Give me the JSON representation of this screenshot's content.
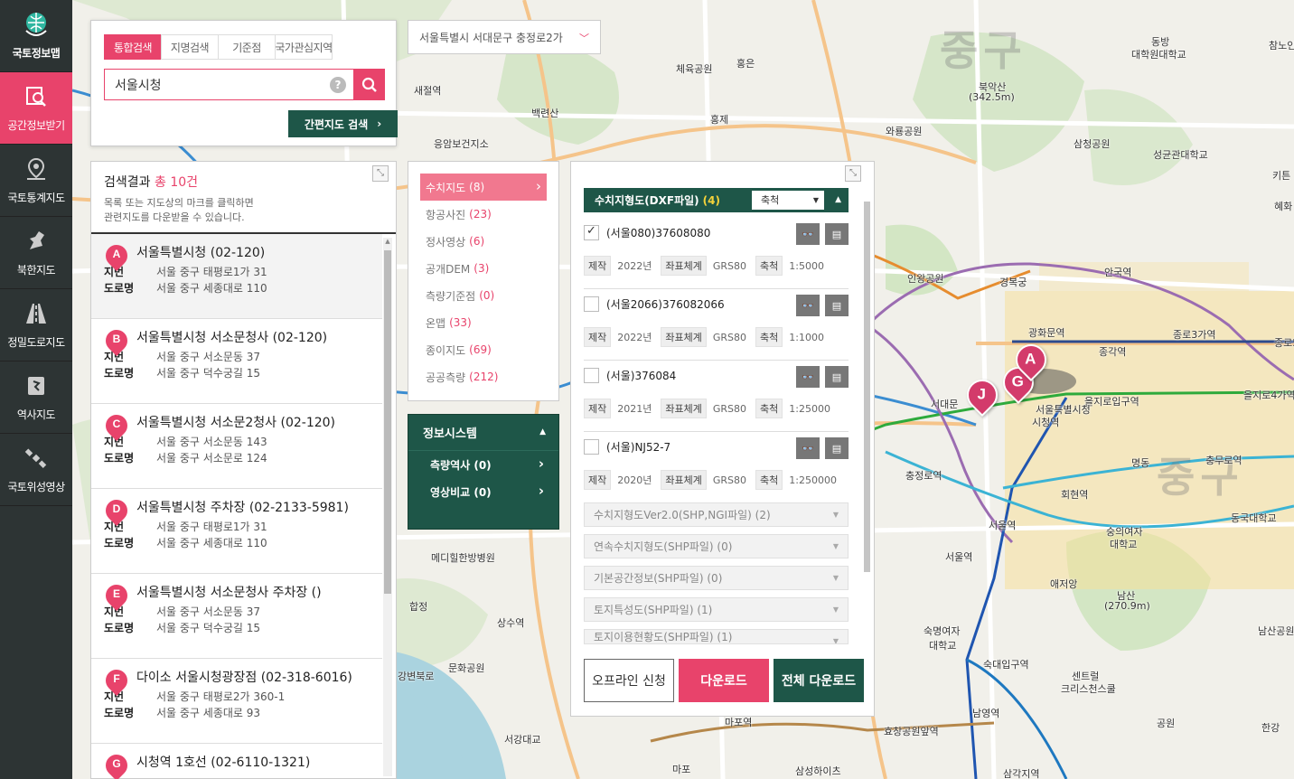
{
  "nav": [
    {
      "label": "국토정보맵",
      "icon": "globe-icon"
    },
    {
      "label": "공간정보받기",
      "icon": "map-search-icon"
    },
    {
      "label": "국토통계지도",
      "icon": "map-pin-icon"
    },
    {
      "label": "북한지도",
      "icon": "north-korea-map-icon"
    },
    {
      "label": "정밀도로지도",
      "icon": "road-icon"
    },
    {
      "label": "역사지도",
      "icon": "history-map-icon"
    },
    {
      "label": "국토위성영상",
      "icon": "satellite-icon"
    }
  ],
  "search": {
    "tabs": [
      "통합검색",
      "지명검색",
      "기준점",
      "국가관심지역"
    ],
    "query": "서울시청",
    "help": "?",
    "simple_btn": "간편지도 검색"
  },
  "address": "서울특별시 서대문구 충정로2가",
  "results": {
    "title_prefix": "검색결과",
    "title_total": "총 10건",
    "desc_line1": "목록 또는 지도상의 마크를 클릭하면",
    "desc_line2": "관련지도를 다운받을 수 있습니다.",
    "lot_label": "지번",
    "road_label": "도로명",
    "items": [
      {
        "marker": "A",
        "name": "서울특별시청 (02-120)",
        "lot": "서울 중구 태평로1가 31",
        "road": "서울 중구 세종대로 110"
      },
      {
        "marker": "B",
        "name": "서울특별시청 서소문청사 (02-120)",
        "lot": "서울 중구 서소문동 37",
        "road": "서울 중구 덕수궁길 15"
      },
      {
        "marker": "C",
        "name": "서울특별시청 서소문2청사 (02-120)",
        "lot": "서울 중구 서소문동 143",
        "road": "서울 중구 서소문로 124"
      },
      {
        "marker": "D",
        "name": "서울특별시청 주차장 (02-2133-5981)",
        "lot": "서울 중구 태평로1가 31",
        "road": "서울 중구 세종대로 110"
      },
      {
        "marker": "E",
        "name": "서울특별시청 서소문청사 주차장 ()",
        "lot": "서울 중구 서소문동 37",
        "road": "서울 중구 덕수궁길 15"
      },
      {
        "marker": "F",
        "name": "다이소 서울시청광장점 (02-318-6016)",
        "lot": "서울 중구 태평로2가 360-1",
        "road": "서울 중구 세종대로 93"
      },
      {
        "marker": "G",
        "name": "시청역 1호선 (02-6110-1321)",
        "lot": "",
        "road": ""
      }
    ]
  },
  "categories": [
    {
      "label": "수치지도",
      "count": "(8)"
    },
    {
      "label": "항공사진",
      "count": "(23)"
    },
    {
      "label": "정사영상",
      "count": "(6)"
    },
    {
      "label": "공개DEM",
      "count": "(3)"
    },
    {
      "label": "측량기준점",
      "count": "(0)"
    },
    {
      "label": "온맵",
      "count": "(33)"
    },
    {
      "label": "종이지도",
      "count": "(69)"
    },
    {
      "label": "공공측량",
      "count": "(212)"
    }
  ],
  "infosys": {
    "title": "정보시스템",
    "items": [
      "측량역사 (0)",
      "영상비교 (0)"
    ]
  },
  "download": {
    "header": "수치지형도(DXF파일)",
    "header_count": "(4)",
    "scale_select": "축척",
    "tag_made": "제작",
    "tag_crs": "좌표체계",
    "tag_scale": "축척",
    "items": [
      {
        "name": "(서울080)37608080",
        "checked": true,
        "year": "2022년",
        "crs": "GRS80",
        "scale": "1:5000"
      },
      {
        "name": "(서울2066)376082066",
        "checked": false,
        "year": "2022년",
        "crs": "GRS80",
        "scale": "1:1000"
      },
      {
        "name": "(서울)376084",
        "checked": false,
        "year": "2021년",
        "crs": "GRS80",
        "scale": "1:25000"
      },
      {
        "name": "(서울)NJ52-7",
        "checked": false,
        "year": "2020년",
        "crs": "GRS80",
        "scale": "1:250000"
      }
    ],
    "accordions": [
      "수치지형도Ver2.0(SHP,NGI파일) (2)",
      "연속수치지형도(SHP파일) (0)",
      "기본공간정보(SHP파일) (0)",
      "토지특성도(SHP파일) (1)",
      "토지이용현황도(SHP파일) (1)"
    ],
    "btn_offline": "오프라인 신청",
    "btn_download": "다운로드",
    "btn_all": "전체 다운로드"
  },
  "map_labels": [
    "중구",
    "중구",
    "동방",
    "대학원대학교",
    "참노인",
    "홍은",
    "체육공원",
    "새절역",
    "백련산",
    "홍제",
    "북악산",
    "(342.5m)",
    "응암보건지소",
    "삼청공원",
    "성균관대학교",
    "와룡공원",
    "혜화",
    "키튼",
    "경복궁",
    "안국역",
    "인왕공원",
    "광화문역",
    "종각역",
    "종로3가역",
    "종로5",
    "을지로입구역",
    "을지로4가역",
    "서대문",
    "시청역",
    "서울특별시청",
    "충정로역",
    "명동",
    "충무로역",
    "동국대학교",
    "회현역",
    "서울역",
    "숭의여자",
    "대학교",
    "애저앙",
    "남산",
    "(270.9m)",
    "남산공원",
    "숙명여자",
    "대학교",
    "숙대입구역",
    "센트럴",
    "크리스천스쿨",
    "남영역",
    "효창공원앞역",
    "한강",
    "공원",
    "합정",
    "상수역",
    "문화공원",
    "메디힐한방병원",
    "마포역",
    "마포",
    "삼성하이츠",
    "삼각지역",
    "서강대교",
    "강변북로",
    "서울역"
  ]
}
